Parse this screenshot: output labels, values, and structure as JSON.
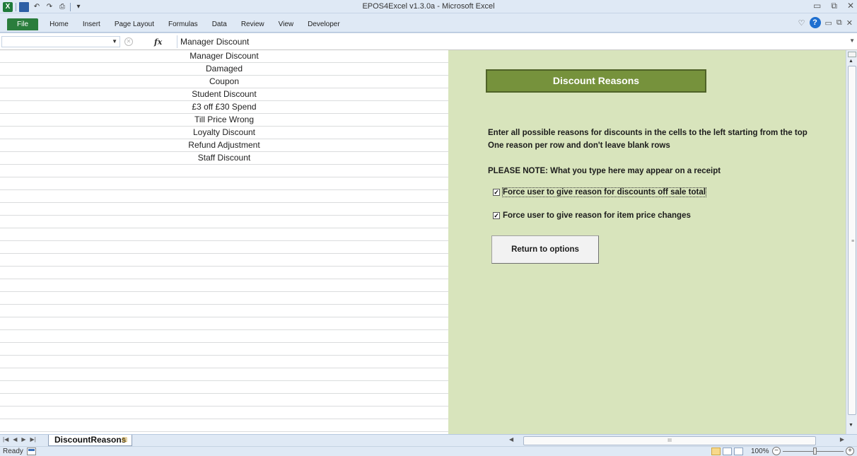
{
  "window": {
    "title": "EPOS4Excel v1.3.0a - Microsoft Excel"
  },
  "ribbon": {
    "tabs": [
      "File",
      "Home",
      "Insert",
      "Page Layout",
      "Formulas",
      "Data",
      "Review",
      "View",
      "Developer"
    ]
  },
  "formula_bar": {
    "name_box": "",
    "formula": "Manager Discount"
  },
  "cells": [
    "Manager Discount",
    "Damaged",
    "Coupon",
    "Student Discount",
    "£3 off £30 Spend",
    "Till Price Wrong",
    "Loyalty Discount",
    "Refund Adjustment",
    "Staff Discount"
  ],
  "panel": {
    "title": "Discount Reasons",
    "instruction_1": "Enter all possible reasons for discounts in the cells to the left starting from the top",
    "instruction_2": "One reason per row and don't leave blank rows",
    "note": "PLEASE NOTE: What you type here may appear on a receipt",
    "checkbox_1": {
      "label": "Force user to give reason for discounts off sale total",
      "checked": true
    },
    "checkbox_2": {
      "label": "Force user to give reason for item price changes",
      "checked": true
    },
    "button": "Return to options",
    "color": "#d8e4bc",
    "title_color": "#76923c"
  },
  "sheet_tabs": {
    "active": "DiscountReasons"
  },
  "status": {
    "text": "Ready",
    "zoom": "100%"
  }
}
